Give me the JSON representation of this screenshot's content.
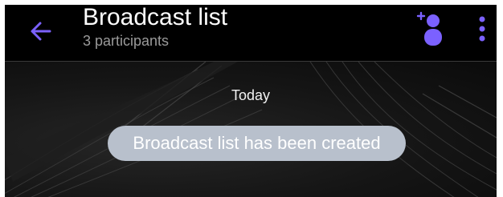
{
  "header": {
    "title": "Broadcast list",
    "subtitle": "3 participants",
    "back_icon": "arrow-left-icon",
    "add_icon": "add-participant-icon",
    "more_icon": "more-vertical-icon",
    "accent_color": "#7b61ff"
  },
  "chat": {
    "date_label": "Today",
    "system_message": "Broadcast list has been created",
    "wallpaper": "dark-feather"
  }
}
